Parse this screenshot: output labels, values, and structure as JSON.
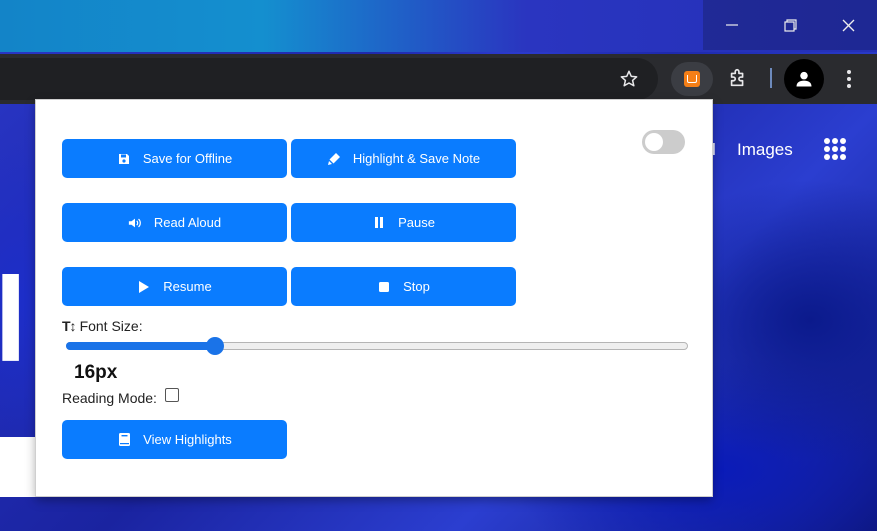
{
  "popup": {
    "buttons": {
      "save_offline": "Save for Offline",
      "highlight_save_note": "Highlight & Save Note",
      "read_aloud": "Read Aloud",
      "pause": "Pause",
      "resume": "Resume",
      "stop": "Stop",
      "view_highlights": "View Highlights"
    },
    "font_size": {
      "label": "Font Size:",
      "value": "16px",
      "slider_fraction": 0.24
    },
    "reading_mode": {
      "label": "Reading Mode:",
      "checked": false
    },
    "toggle_on": false
  },
  "page_behind": {
    "images_link": "Images",
    "sliver_text": "l",
    "big_letter": "l"
  },
  "colors": {
    "button_blue": "#0a7cff",
    "slider_blue": "#1a73e8",
    "toolbar_dark": "#2a2b2f",
    "extension_orange": "#f57f17"
  },
  "icons": [
    "minimize-icon",
    "restore-icon",
    "close-icon",
    "star-icon",
    "extension-icon",
    "puzzle-icon",
    "profile-icon",
    "menu-icon",
    "save-icon",
    "pen-icon",
    "speaker-icon",
    "pause-icon",
    "play-icon",
    "stop-icon",
    "font-size-icon",
    "book-icon",
    "apps-grid-icon"
  ]
}
